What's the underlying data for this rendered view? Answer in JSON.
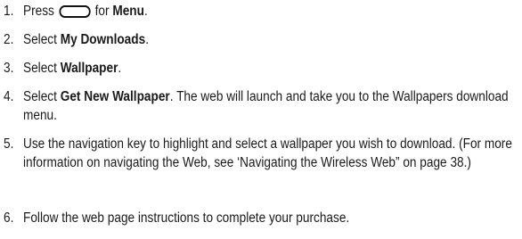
{
  "steps": [
    {
      "number": "1.",
      "parts": [
        "Press",
        "for ",
        "Menu",
        "."
      ]
    },
    {
      "number": "2.",
      "parts": [
        "Select ",
        "My Downloads",
        "."
      ]
    },
    {
      "number": "3.",
      "parts": [
        "Select ",
        "Wallpaper",
        "."
      ]
    },
    {
      "number": "4.",
      "parts": [
        "Select ",
        "Get New Wallpaper",
        ". The web will launch and take you to the Wallpapers download menu."
      ]
    },
    {
      "number": "5.",
      "parts": [
        "Use the navigation key to highlight and select a wallpaper you wish to download. (For more information on navigating the Web, see ‘Navigating the Wireless Web” on page 38.)"
      ]
    },
    {
      "number": "6.",
      "parts": [
        "Follow the web page instructions to complete your purchase."
      ]
    }
  ],
  "icons": {
    "menu_key": "menu-softkey-icon"
  }
}
